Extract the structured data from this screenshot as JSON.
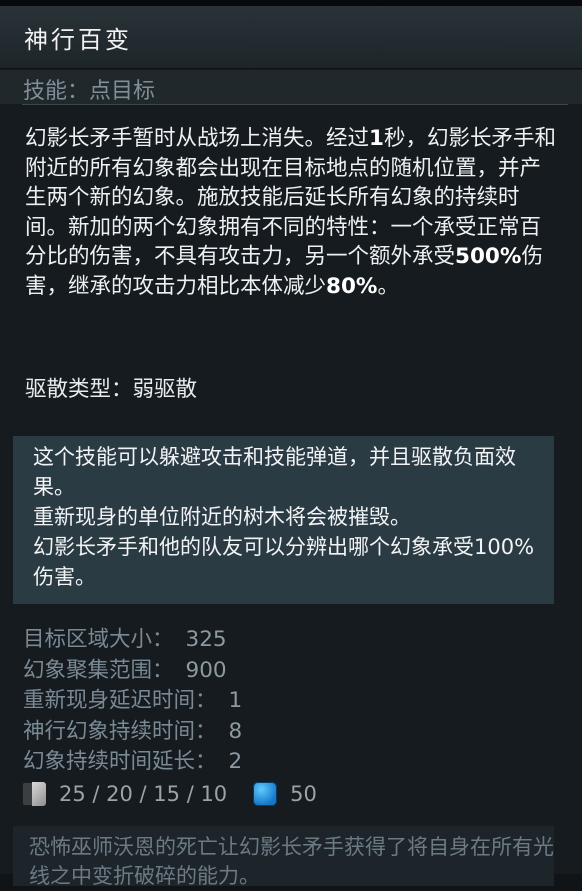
{
  "header": {
    "title": "神行百变"
  },
  "skill_type": "技能：点目标",
  "description": {
    "parts": [
      {
        "text": "幻影长矛手暂时从战场上消失。经过",
        "bold": false
      },
      {
        "text": "1",
        "bold": true
      },
      {
        "text": "秒，幻影长矛手和附近的所有幻象都会出现在目标地点的随机位置，并产生两个新的幻象。施放技能后延长所有幻象的持续时间。新加的两个幻象拥有不同的特性：一个承受正常百分比的伤害，不具有攻击力，另一个额外承受",
        "bold": false
      },
      {
        "text": "500%",
        "bold": true
      },
      {
        "text": "伤害，继承的攻击力相比本体减少",
        "bold": false
      },
      {
        "text": "80%",
        "bold": true
      },
      {
        "text": "。",
        "bold": false
      }
    ]
  },
  "dispel": "驱散类型：弱驱散",
  "notes": [
    "这个技能可以躲避攻击和技能弹道，并且驱散负面效果。",
    "重新现身的单位附近的树木将会被摧毁。",
    "幻影长矛手和他的队友可以分辨出哪个幻象承受100%伤害。"
  ],
  "attributes": [
    {
      "label": "目标区域大小：",
      "value": "325"
    },
    {
      "label": "幻象聚集范围：",
      "value": "900"
    },
    {
      "label": "重新现身延迟时间：",
      "value": "1"
    },
    {
      "label": "神行幻象持续时间：",
      "value": "8"
    },
    {
      "label": "幻象持续时间延长：",
      "value": "2"
    }
  ],
  "costs": {
    "cooldown": "25 / 20 / 15 / 10",
    "mana": "50",
    "cooldown_icon": "cooldown-icon",
    "mana_icon": "mana-icon"
  },
  "lore": "恐怖巫师沃恩的死亡让幻影长矛手获得了将自身在所有光线之中变折破碎的能力。",
  "colors": {
    "background": "#151b1f",
    "header": "#293338",
    "notes_background": "#2b3b44",
    "muted_text": "#7a8a94",
    "mana": "#1e8fe0"
  }
}
